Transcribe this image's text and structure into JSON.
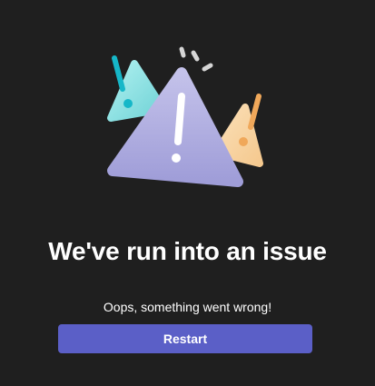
{
  "error": {
    "headline": "We've run into an issue",
    "message": "Oops, something went wrong!",
    "restart_label": "Restart"
  },
  "illustration": {
    "icon": "warning-triangles-icon",
    "colors": {
      "main_triangle": "#a9a8dd",
      "left_triangle": "#7fd9dc",
      "right_triangle": "#f7cf98",
      "exclamation": "#ffffff",
      "left_accent": "#16b7c8",
      "right_accent": "#f0a85a",
      "sparks": "#d6d6d6"
    }
  },
  "theme": {
    "background": "#1f1f1f",
    "accent": "#5b5fc7",
    "text": "#ffffff"
  }
}
